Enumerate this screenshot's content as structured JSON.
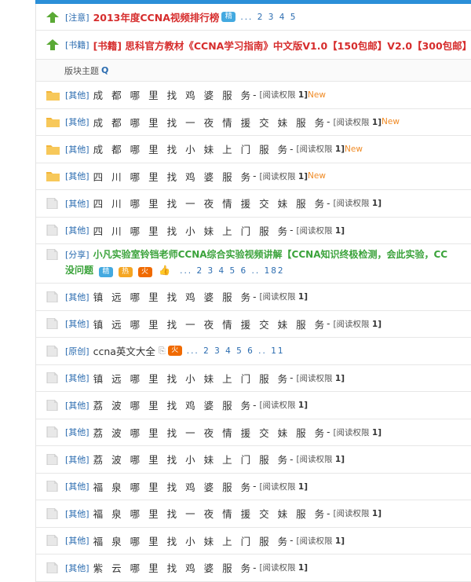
{
  "notices": [
    {
      "category": "[注意]",
      "title": "2013年度CCNA视频排行榜",
      "badge": "精",
      "pages": "... 2 3 4 5"
    },
    {
      "category": "[书籍]",
      "title": "[书籍] 思科官方教材《CCNA学习指南》中文版V1.0【150包邮】V2.0【300包邮】"
    }
  ],
  "subheader": {
    "label": "版块主题",
    "icon": "search-icon"
  },
  "threads": [
    {
      "cat": "[其他]",
      "title": "成都哪里找鸡婆服务",
      "perm_label": "[阅读权限",
      "perm_value": "1]",
      "new": "New",
      "icon": "folder-new"
    },
    {
      "cat": "[其他]",
      "title": "成都哪里找一夜情援交妹服务",
      "perm_label": "[阅读权限",
      "perm_value": "1]",
      "new": "New",
      "icon": "folder-new"
    },
    {
      "cat": "[其他]",
      "title": "成都哪里找小妹上门服务",
      "perm_label": "[阅读权限",
      "perm_value": "1]",
      "new": "New",
      "icon": "folder-new"
    },
    {
      "cat": "[其他]",
      "title": "四川哪里找鸡婆服务",
      "perm_label": "[阅读权限",
      "perm_value": "1]",
      "new": "New",
      "icon": "folder-new"
    },
    {
      "cat": "[其他]",
      "title": "四川哪里找一夜情援交妹服务",
      "perm_label": "[阅读权限",
      "perm_value": "1]",
      "icon": "doc"
    },
    {
      "cat": "[其他]",
      "title": "四川哪里找小妹上门服务",
      "perm_label": "[阅读权限",
      "perm_value": "1]",
      "icon": "doc"
    }
  ],
  "special": {
    "cat": "[分享]",
    "title_line1": "小凡实验室铃铛老师CCNA综合实验视频讲解【CCNA知识终极检测，会此实验，CC",
    "title_line2": "没问题",
    "badges": [
      "精",
      "热",
      "火",
      "👍"
    ],
    "pages": "... 2 3 4 5 6 .. 182"
  },
  "threads2": [
    {
      "cat": "[其他]",
      "title": "镇远哪里找鸡婆服务",
      "perm_label": "[阅读权限",
      "perm_value": "1]"
    },
    {
      "cat": "[其他]",
      "title": "镇远哪里找一夜情援交妹服务",
      "perm_label": "[阅读权限",
      "perm_value": "1]"
    }
  ],
  "original": {
    "cat": "[原创]",
    "title": "ccna英文大全",
    "badge": "火",
    "pages": "... 2 3 4 5 6 .. 11"
  },
  "threads3": [
    {
      "cat": "[其他]",
      "title": "镇远哪里找小妹上门服务",
      "perm_label": "[阅读权限",
      "perm_value": "1]"
    },
    {
      "cat": "[其他]",
      "title": "荔波哪里找鸡婆服务",
      "perm_label": "[阅读权限",
      "perm_value": "1]"
    },
    {
      "cat": "[其他]",
      "title": "荔波哪里找一夜情援交妹服务",
      "perm_label": "[阅读权限",
      "perm_value": "1]"
    },
    {
      "cat": "[其他]",
      "title": "荔波哪里找小妹上门服务",
      "perm_label": "[阅读权限",
      "perm_value": "1]"
    },
    {
      "cat": "[其他]",
      "title": "福泉哪里找鸡婆服务",
      "perm_label": "[阅读权限",
      "perm_value": "1]"
    },
    {
      "cat": "[其他]",
      "title": "福泉哪里找一夜情援交妹服务",
      "perm_label": "[阅读权限",
      "perm_value": "1]"
    },
    {
      "cat": "[其他]",
      "title": "福泉哪里找小妹上门服务",
      "perm_label": "[阅读权限",
      "perm_value": "1]"
    },
    {
      "cat": "[其他]",
      "title": "紫云哪里找鸡婆服务",
      "perm_label": "[阅读权限",
      "perm_value": "1]"
    }
  ]
}
